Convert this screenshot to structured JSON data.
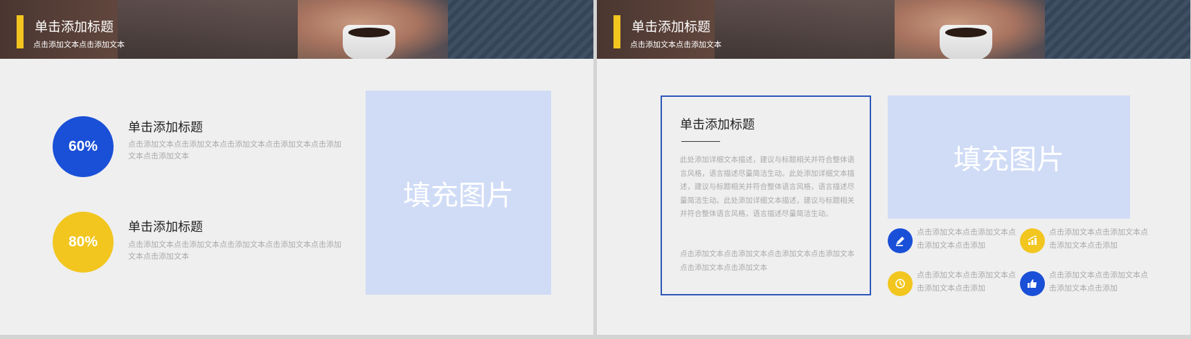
{
  "header": {
    "title": "单击添加标题",
    "subtitle": "点击添加文本点击添加文本"
  },
  "slide1": {
    "items": [
      {
        "percent": "60%",
        "title": "单击添加标题",
        "desc": "点击添加文本点击添加文本点击添加文本点击添加文本点击添加文本点击添加文本"
      },
      {
        "percent": "80%",
        "title": "单击添加标题",
        "desc": "点击添加文本点击添加文本点击添加文本点击添加文本点击添加文本点击添加文本"
      }
    ],
    "placeholder": "填充图片"
  },
  "slide2": {
    "card": {
      "title": "单击添加标题",
      "body": "此处添加详细文本描述，建议与标题相关并符合整体语言风格，语言描述尽量简洁生动。此处添加详细文本描述，建议与标题相关并符合整体语言风格，语言描述尽量简洁生动。此处添加详细文本描述，建议与标题相关并符合整体语言风格，语言描述尽量简洁生动。",
      "footer": "点击添加文本点击添加文本点击添加文本点击添加文本点击添加文本点击添加文本"
    },
    "placeholder": "填充图片",
    "features": [
      {
        "text": "点击添加文本点击添加文本点击添加文本点击添加",
        "icon": "pen-icon"
      },
      {
        "text": "点击添加文本点击添加文本点击添加文本点击添加",
        "icon": "growth-chart-icon"
      },
      {
        "text": "点击添加文本点击添加文本点击添加文本点击添加",
        "icon": "clock-icon"
      },
      {
        "text": "点击添加文本点击添加文本点击添加文本点击添加",
        "icon": "thumbs-up-icon"
      }
    ]
  },
  "colors": {
    "accent_blue": "#1a4fd7",
    "accent_yellow": "#f2c61f",
    "placeholder_fill": "#d0dcf6",
    "card_border": "#2a55b8"
  }
}
